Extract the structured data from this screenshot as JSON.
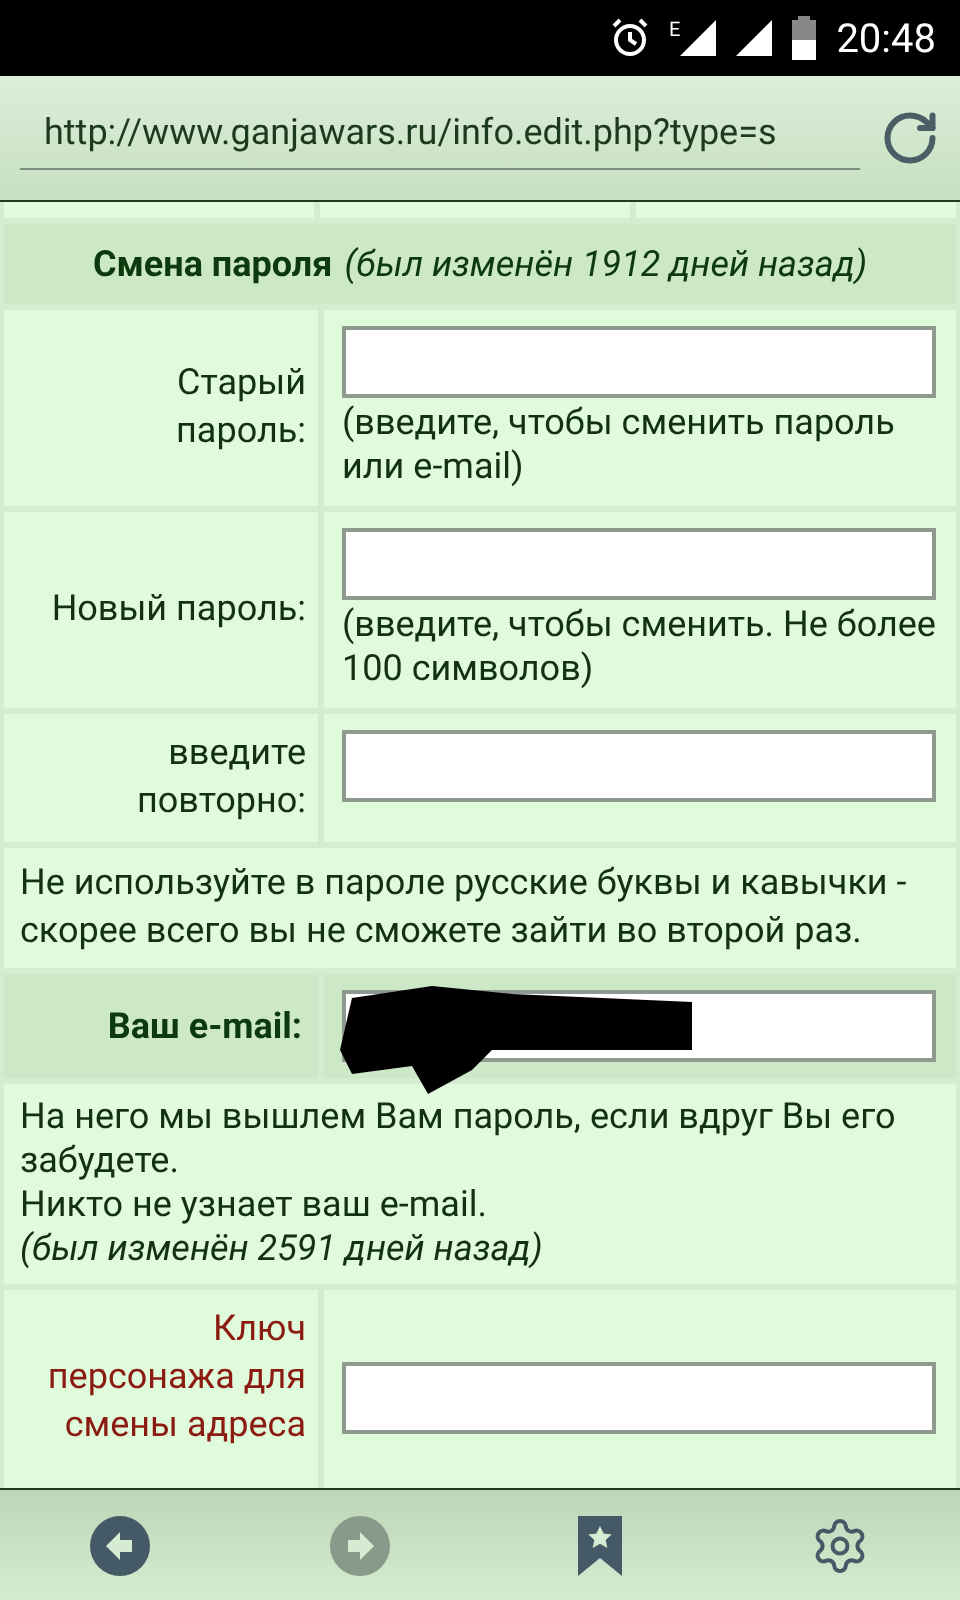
{
  "status_bar": {
    "network": "E",
    "time": "20:48"
  },
  "address_bar": {
    "url": "http://www.ganjawars.ru/info.edit.php?type=s"
  },
  "password_section": {
    "title": "Смена пароля",
    "note": "(был изменён 1912 дней назад)"
  },
  "fields": [
    {
      "label": "Старый\nпароль:",
      "hint": "(введите, чтобы сменить пароль или e-mail)"
    },
    {
      "label": "Новый пароль:",
      "hint": "(введите, чтобы сменить. Не более 100 символов)"
    },
    {
      "label": "введите\nповторно:"
    }
  ],
  "warning": "Не используйте в пароле русские буквы и кавычки - скорее всего вы не сможете зайти во второй раз.",
  "email": {
    "label": "Ваш e-mail:",
    "redacted": true
  },
  "email_notes": [
    "На него мы вышлем Вам пароль, если вдруг Вы его забудете.",
    "Никто не узнает ваш e-mail."
  ],
  "email_changed": "(был изменён 2591 дней назад)",
  "key_field": {
    "label": "Ключ\nперсонажа для\nсмены адреса"
  },
  "toolbar": [
    {
      "kind": "back",
      "disabled": false
    },
    {
      "kind": "forward",
      "disabled": true
    },
    {
      "kind": "bookmarks",
      "disabled": false
    },
    {
      "kind": "settings",
      "disabled": false
    }
  ]
}
